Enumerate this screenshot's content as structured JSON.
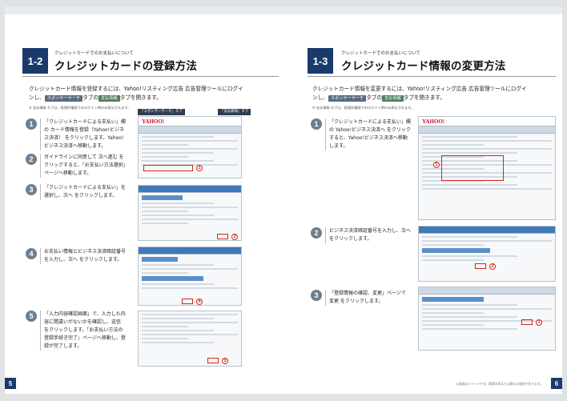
{
  "left": {
    "section_number": "1-2",
    "subtitle": "クレジットカードでのお支払いについて",
    "title": "クレジットカードの登録方法",
    "lead_line1": "クレジットカード情報を登録するには、Yahoo!リスティング広告 広告管理ツールにログイ",
    "lead_line2_pre": "ンし、",
    "lead_tag1": "スポンサーサーチ",
    "lead_line2_mid": "タブの",
    "lead_tag2": "支払情報",
    "lead_line2_post": "タブを開きます。",
    "note": "※ 支払情報 タブは、経理所権限でのログイン時のみ表示されます。",
    "callout1": "「スポンサーサーチ」タブ",
    "callout2": "「支払情報」タブ",
    "steps": [
      {
        "num": "1",
        "text": "「クレジットカードによる支払い」欄の カード情報を登録（Yahoo!ビジネス決済） をクリックします。Yahoo!ビジネス決済へ移動します。"
      },
      {
        "num": "2",
        "text": "ガイドラインに同意して 次へ進む をクリックすると、「お支払い方法選択」ページへ移動します。"
      },
      {
        "num": "3",
        "text": "「クレジットカードによる支払い」を選択し、次へ をクリックします。"
      },
      {
        "num": "4",
        "text": "お支払い情報とビジネス決済暗証番号を入力し、次へ をクリックします。"
      },
      {
        "num": "5",
        "text": "「入力内容確認画面」で、入力した内容に間違いがないかを確認し、送信 をクリックします。「お支払い方法の登録手続き完了」ページへ移動し、登録が完了します。"
      }
    ],
    "shot_logo": "YAHOO!",
    "page_number": "5"
  },
  "right": {
    "section_number": "1-3",
    "subtitle": "クレジットカードでのお支払いについて",
    "title": "クレジットカード情報の変更方法",
    "lead_line1": "クレジットカード情報を変更するには、Yahoo!リスティング広告 広告管理ツールにログイ",
    "lead_line2_pre": "ンし、",
    "lead_tag1": "スポンサーサーチ",
    "lead_line2_mid": "タブの",
    "lead_tag2": "支払情報",
    "lead_line2_post": "タブを開きます。",
    "note": "※ 支払情報 タブは、経理所権限でのログイン時のみ表示されます。",
    "steps": [
      {
        "num": "1",
        "text": "「クレジットカードによる支払い」欄の Yahoo!ビジネス決済へ をクリックすると、Yahoo!ビジネス決済へ移動します。"
      },
      {
        "num": "2",
        "text": "ビジネス決済暗証番号を入力し、次へ をクリックします。"
      },
      {
        "num": "3",
        "text": "「登録情報の確認、変更」ページで 変更 をクリックします。"
      }
    ],
    "shot_logo": "YAHOO!",
    "footer": "※画面はイメージです。実際の表示とは異なる場合があります。",
    "page_number": "6"
  }
}
